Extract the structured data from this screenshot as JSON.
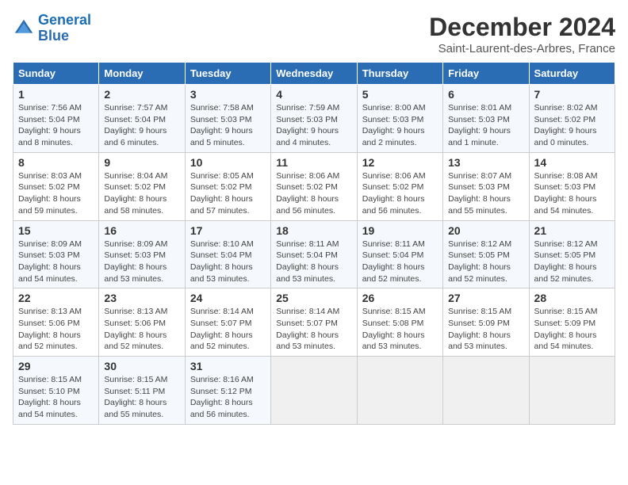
{
  "header": {
    "logo_line1": "General",
    "logo_line2": "Blue",
    "title": "December 2024",
    "subtitle": "Saint-Laurent-des-Arbres, France"
  },
  "weekdays": [
    "Sunday",
    "Monday",
    "Tuesday",
    "Wednesday",
    "Thursday",
    "Friday",
    "Saturday"
  ],
  "weeks": [
    [
      {
        "day": "1",
        "detail": "Sunrise: 7:56 AM\nSunset: 5:04 PM\nDaylight: 9 hours\nand 8 minutes."
      },
      {
        "day": "2",
        "detail": "Sunrise: 7:57 AM\nSunset: 5:04 PM\nDaylight: 9 hours\nand 6 minutes."
      },
      {
        "day": "3",
        "detail": "Sunrise: 7:58 AM\nSunset: 5:03 PM\nDaylight: 9 hours\nand 5 minutes."
      },
      {
        "day": "4",
        "detail": "Sunrise: 7:59 AM\nSunset: 5:03 PM\nDaylight: 9 hours\nand 4 minutes."
      },
      {
        "day": "5",
        "detail": "Sunrise: 8:00 AM\nSunset: 5:03 PM\nDaylight: 9 hours\nand 2 minutes."
      },
      {
        "day": "6",
        "detail": "Sunrise: 8:01 AM\nSunset: 5:03 PM\nDaylight: 9 hours\nand 1 minute."
      },
      {
        "day": "7",
        "detail": "Sunrise: 8:02 AM\nSunset: 5:02 PM\nDaylight: 9 hours\nand 0 minutes."
      }
    ],
    [
      {
        "day": "8",
        "detail": "Sunrise: 8:03 AM\nSunset: 5:02 PM\nDaylight: 8 hours\nand 59 minutes."
      },
      {
        "day": "9",
        "detail": "Sunrise: 8:04 AM\nSunset: 5:02 PM\nDaylight: 8 hours\nand 58 minutes."
      },
      {
        "day": "10",
        "detail": "Sunrise: 8:05 AM\nSunset: 5:02 PM\nDaylight: 8 hours\nand 57 minutes."
      },
      {
        "day": "11",
        "detail": "Sunrise: 8:06 AM\nSunset: 5:02 PM\nDaylight: 8 hours\nand 56 minutes."
      },
      {
        "day": "12",
        "detail": "Sunrise: 8:06 AM\nSunset: 5:02 PM\nDaylight: 8 hours\nand 56 minutes."
      },
      {
        "day": "13",
        "detail": "Sunrise: 8:07 AM\nSunset: 5:03 PM\nDaylight: 8 hours\nand 55 minutes."
      },
      {
        "day": "14",
        "detail": "Sunrise: 8:08 AM\nSunset: 5:03 PM\nDaylight: 8 hours\nand 54 minutes."
      }
    ],
    [
      {
        "day": "15",
        "detail": "Sunrise: 8:09 AM\nSunset: 5:03 PM\nDaylight: 8 hours\nand 54 minutes."
      },
      {
        "day": "16",
        "detail": "Sunrise: 8:09 AM\nSunset: 5:03 PM\nDaylight: 8 hours\nand 53 minutes."
      },
      {
        "day": "17",
        "detail": "Sunrise: 8:10 AM\nSunset: 5:04 PM\nDaylight: 8 hours\nand 53 minutes."
      },
      {
        "day": "18",
        "detail": "Sunrise: 8:11 AM\nSunset: 5:04 PM\nDaylight: 8 hours\nand 53 minutes."
      },
      {
        "day": "19",
        "detail": "Sunrise: 8:11 AM\nSunset: 5:04 PM\nDaylight: 8 hours\nand 52 minutes."
      },
      {
        "day": "20",
        "detail": "Sunrise: 8:12 AM\nSunset: 5:05 PM\nDaylight: 8 hours\nand 52 minutes."
      },
      {
        "day": "21",
        "detail": "Sunrise: 8:12 AM\nSunset: 5:05 PM\nDaylight: 8 hours\nand 52 minutes."
      }
    ],
    [
      {
        "day": "22",
        "detail": "Sunrise: 8:13 AM\nSunset: 5:06 PM\nDaylight: 8 hours\nand 52 minutes."
      },
      {
        "day": "23",
        "detail": "Sunrise: 8:13 AM\nSunset: 5:06 PM\nDaylight: 8 hours\nand 52 minutes."
      },
      {
        "day": "24",
        "detail": "Sunrise: 8:14 AM\nSunset: 5:07 PM\nDaylight: 8 hours\nand 52 minutes."
      },
      {
        "day": "25",
        "detail": "Sunrise: 8:14 AM\nSunset: 5:07 PM\nDaylight: 8 hours\nand 53 minutes."
      },
      {
        "day": "26",
        "detail": "Sunrise: 8:15 AM\nSunset: 5:08 PM\nDaylight: 8 hours\nand 53 minutes."
      },
      {
        "day": "27",
        "detail": "Sunrise: 8:15 AM\nSunset: 5:09 PM\nDaylight: 8 hours\nand 53 minutes."
      },
      {
        "day": "28",
        "detail": "Sunrise: 8:15 AM\nSunset: 5:09 PM\nDaylight: 8 hours\nand 54 minutes."
      }
    ],
    [
      {
        "day": "29",
        "detail": "Sunrise: 8:15 AM\nSunset: 5:10 PM\nDaylight: 8 hours\nand 54 minutes."
      },
      {
        "day": "30",
        "detail": "Sunrise: 8:15 AM\nSunset: 5:11 PM\nDaylight: 8 hours\nand 55 minutes."
      },
      {
        "day": "31",
        "detail": "Sunrise: 8:16 AM\nSunset: 5:12 PM\nDaylight: 8 hours\nand 56 minutes."
      },
      {
        "day": "",
        "detail": ""
      },
      {
        "day": "",
        "detail": ""
      },
      {
        "day": "",
        "detail": ""
      },
      {
        "day": "",
        "detail": ""
      }
    ]
  ]
}
